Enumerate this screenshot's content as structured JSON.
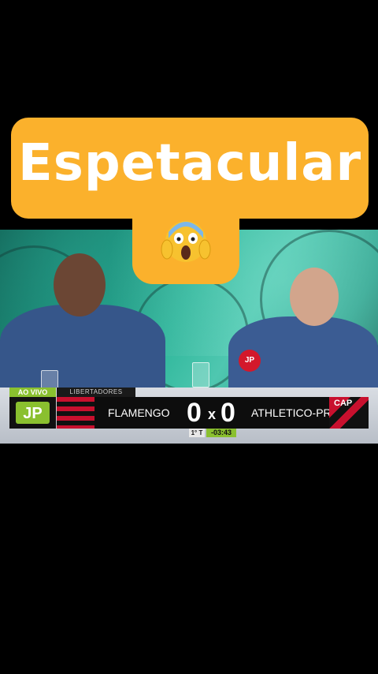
{
  "caption": {
    "title": "Espetacular",
    "emoji": "😱"
  },
  "scoreboard": {
    "live_label": "AO VIVO",
    "competition": "LIBERTADORES",
    "home_team": "FLAMENGO",
    "home_score": "0",
    "separator": "x",
    "away_score": "0",
    "away_team": "ATHLETICO-PR",
    "period": "1° T",
    "clock": "-03:43",
    "away_badge": "CAP"
  },
  "colors": {
    "caption_bg": "#fbb12c",
    "live_green": "#8ac02f",
    "flamengo_red": "#c8102e"
  }
}
